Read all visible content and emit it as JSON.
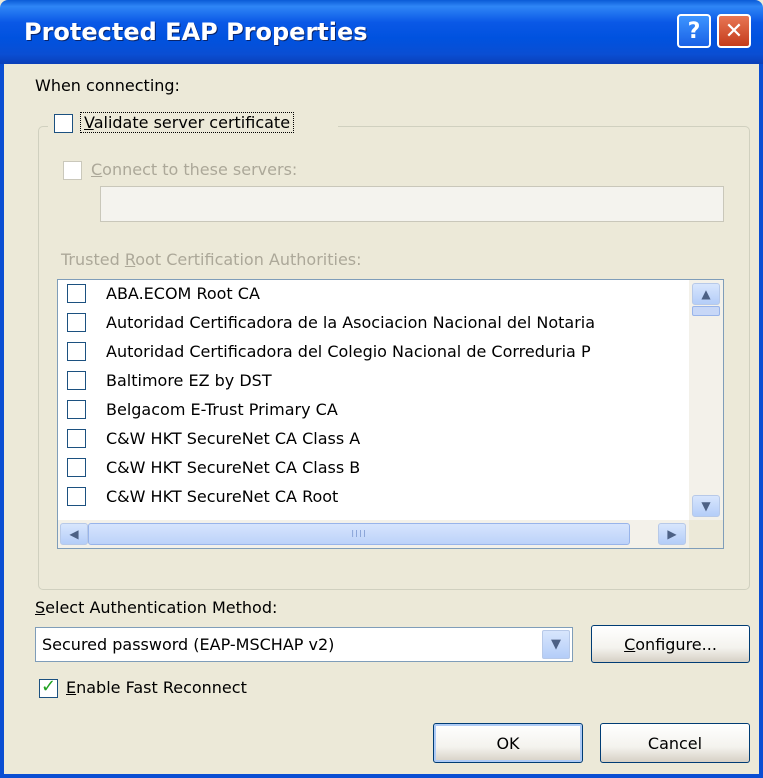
{
  "window": {
    "title": "Protected EAP Properties",
    "help_glyph": "?",
    "close_glyph": "✕"
  },
  "when_connecting_label": "When connecting:",
  "validate_server_certificate": {
    "label_first": "V",
    "label_rest": "alidate server certificate",
    "checked": false
  },
  "connect_to_servers": {
    "label_first": "C",
    "label_rest": "onnect to these servers:",
    "checked": false,
    "value": ""
  },
  "trusted_root": {
    "label_prefix": "Trusted ",
    "label_u": "R",
    "label_rest": "oot Certification Authorities:",
    "items": [
      {
        "label": "ABA.ECOM Root CA",
        "checked": false
      },
      {
        "label": "Autoridad Certificadora de la Asociacion Nacional del Notaria",
        "checked": false
      },
      {
        "label": "Autoridad Certificadora del Colegio Nacional de Correduria P",
        "checked": false
      },
      {
        "label": "Baltimore EZ by DST",
        "checked": false
      },
      {
        "label": "Belgacom E-Trust Primary CA",
        "checked": false
      },
      {
        "label": "C&W HKT SecureNet CA Class A",
        "checked": false
      },
      {
        "label": "C&W HKT SecureNet CA Class B",
        "checked": false
      },
      {
        "label": "C&W HKT SecureNet CA Root",
        "checked": false
      }
    ],
    "hthumb_glyph": "IIII"
  },
  "auth_method": {
    "label_first": "S",
    "label_rest": "elect Authentication Method:",
    "selected": "Secured password (EAP-MSCHAP v2)"
  },
  "configure_button": {
    "label_first": "C",
    "label_rest": "onfigure..."
  },
  "fast_reconnect": {
    "label_first": "E",
    "label_rest": "nable Fast Reconnect",
    "checked": true
  },
  "ok_label": "OK",
  "cancel_label": "Cancel",
  "icons": {
    "up": "▲",
    "down": "▼",
    "left": "◀",
    "right": "▶"
  },
  "colors": {
    "titlebar": "#0a58e6",
    "dialog_bg": "#ece9d8",
    "check_green": "#21a121"
  }
}
